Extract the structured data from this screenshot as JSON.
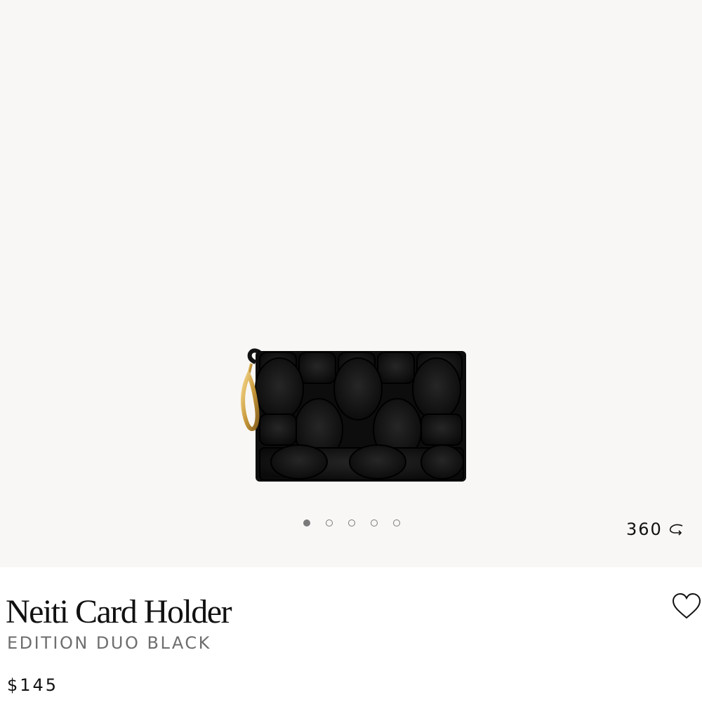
{
  "gallery": {
    "image_alt": "Neiti Card Holder",
    "dots": [
      {
        "active": true
      },
      {
        "active": false
      },
      {
        "active": false
      },
      {
        "active": false
      },
      {
        "active": false
      }
    ],
    "view360_label": "360",
    "view360_icon": "rotate-icon",
    "background": "#f8f7f5"
  },
  "product": {
    "title": "Neiti Card Holder",
    "edition": "EDITION DUO BLACK",
    "price": "$145",
    "favorite_icon": "heart-icon"
  }
}
